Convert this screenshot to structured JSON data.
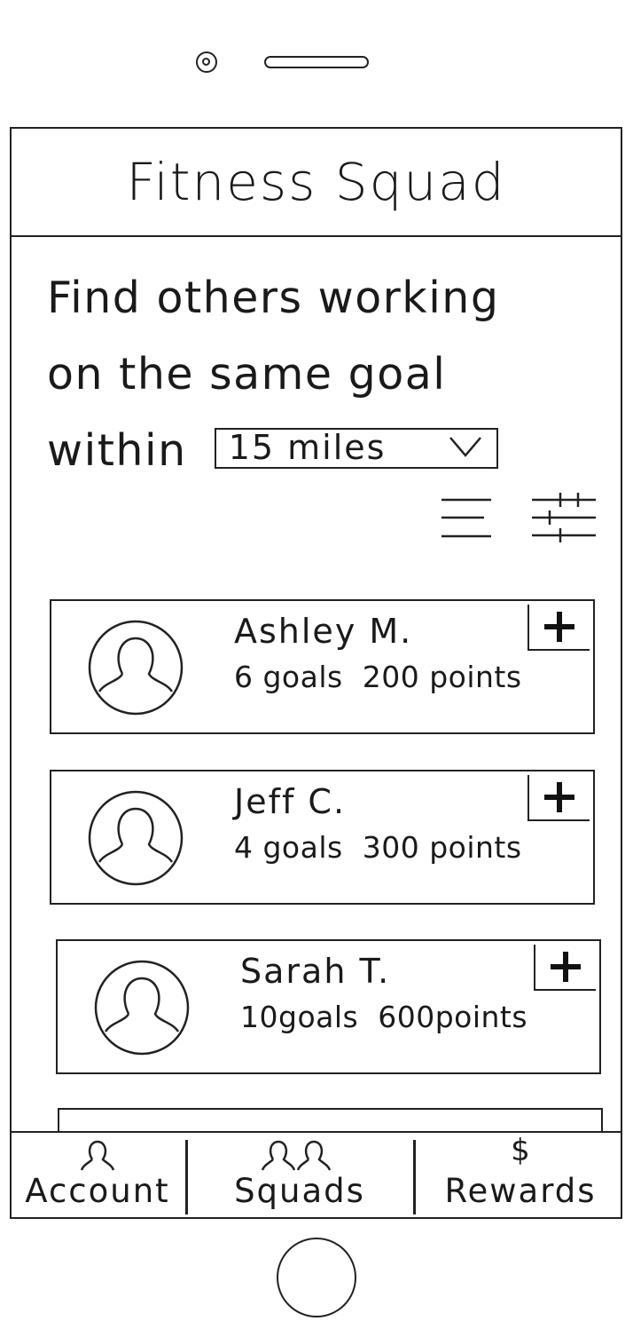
{
  "app": {
    "title": "Fitness Squad"
  },
  "search": {
    "headline_line1": "Find others working",
    "headline_line2": "on the same goal",
    "headline_prefix": "within",
    "distance_selected": "15 miles"
  },
  "icons": {
    "list_view": "list-icon",
    "filters": "sliders-icon",
    "avatar": "user-icon",
    "add": "plus-icon"
  },
  "members": [
    {
      "name": "Ashley M.",
      "goals": "6 goals",
      "points": "200 points"
    },
    {
      "name": "Jeff C.",
      "goals": "4 goals",
      "points": "300 points"
    },
    {
      "name": "Sarah T.",
      "goals": "10goals",
      "points": "600points"
    }
  ],
  "tabs": [
    {
      "label": "Account",
      "icon": "user-icon"
    },
    {
      "label": "Squads",
      "icon": "group-icon"
    },
    {
      "label": "Rewards",
      "icon": "dollar-icon"
    }
  ]
}
